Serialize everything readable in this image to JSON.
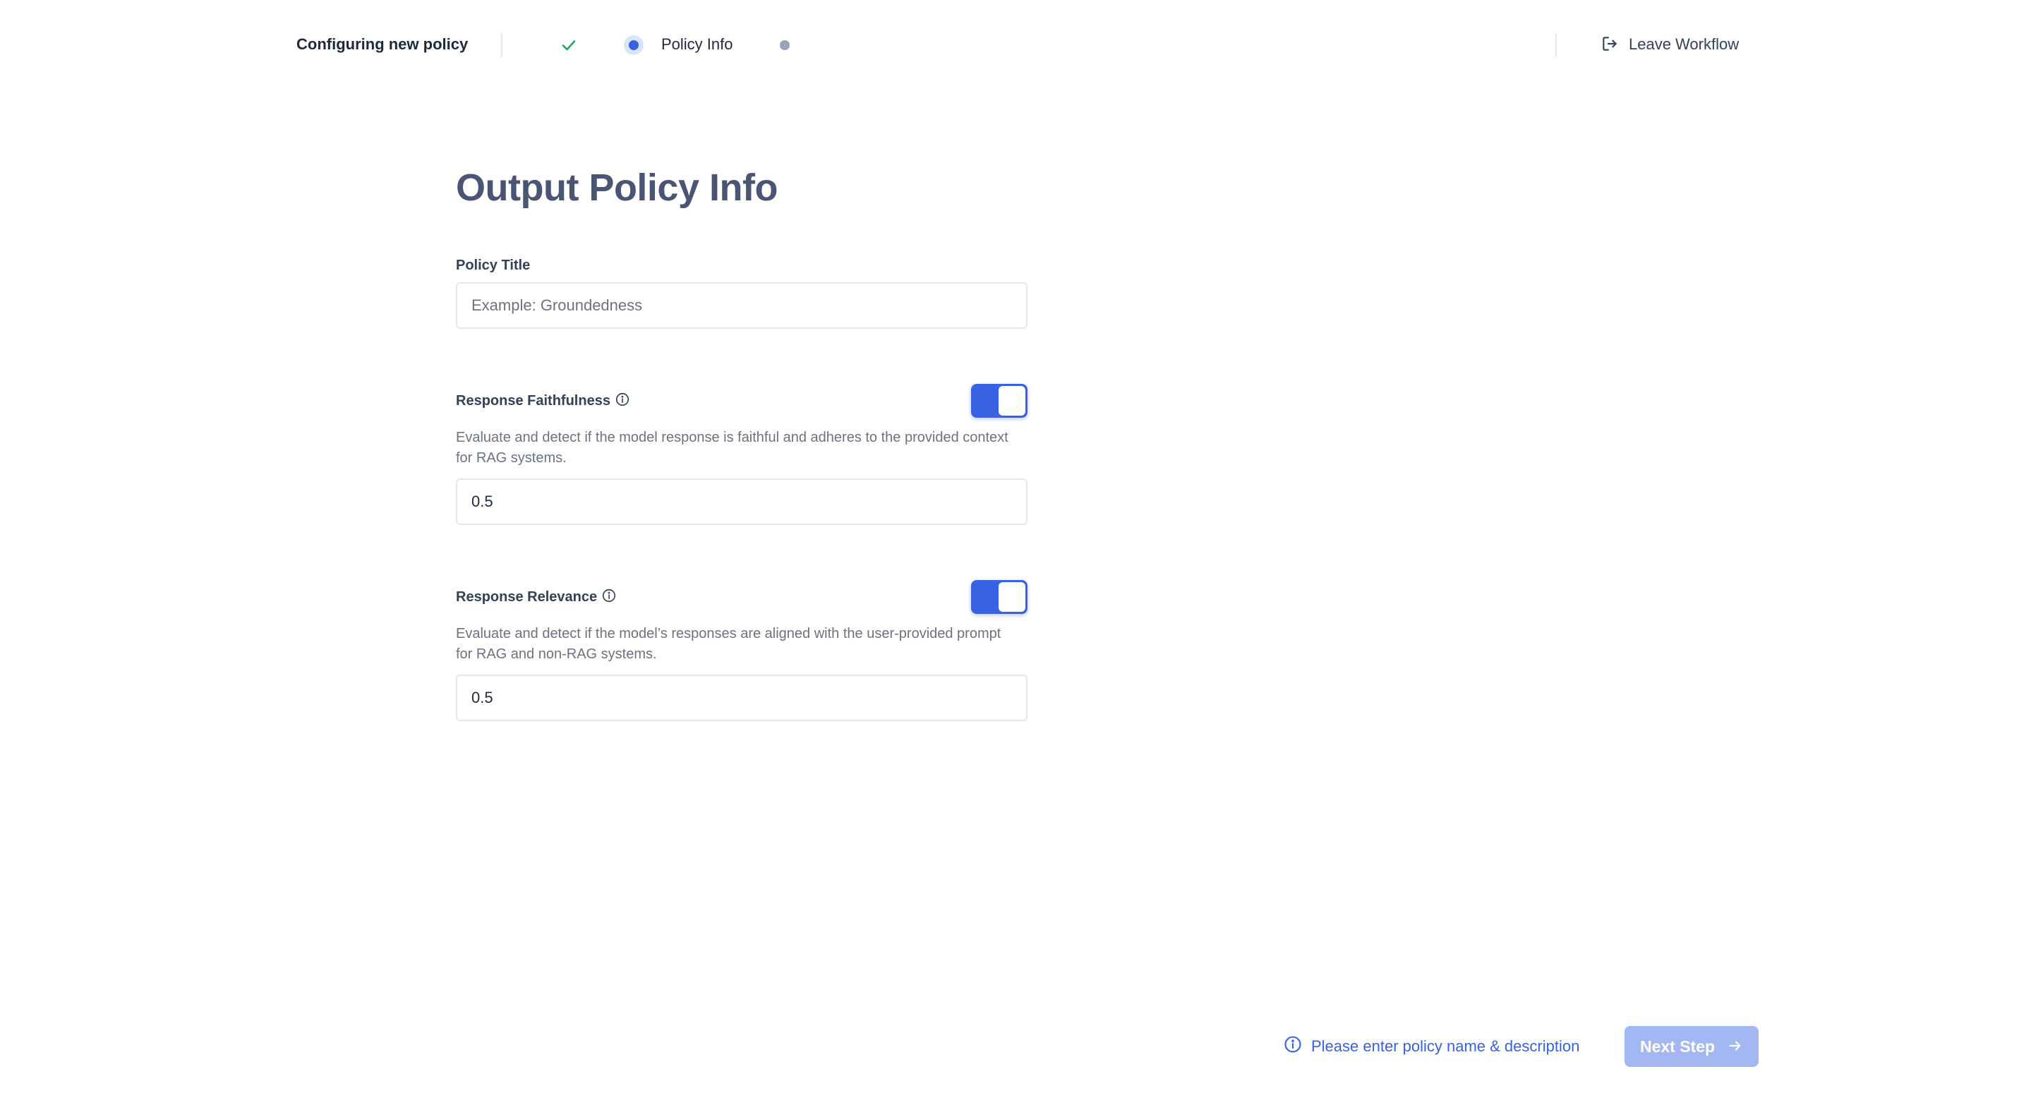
{
  "header": {
    "workflow_title": "Configuring new policy",
    "steps": [
      {
        "state": "completed",
        "icon": "check-icon"
      },
      {
        "state": "current",
        "label": "Policy Info"
      },
      {
        "state": "pending"
      }
    ],
    "leave_label": "Leave Workflow",
    "leave_icon": "exit-icon"
  },
  "form": {
    "title": "Output Policy Info",
    "policy_title": {
      "label": "Policy Title",
      "placeholder": "Example: Groundedness",
      "value": ""
    },
    "policies": [
      {
        "label": "Response Faithfulness",
        "enabled": true,
        "description": "Evaluate and detect if the model response is faithful and adheres to the provided context for RAG systems.",
        "threshold": "0.5"
      },
      {
        "label": "Response Relevance",
        "enabled": true,
        "description": "Evaluate and detect if the model’s responses are aligned with the user-provided prompt for RAG and non-RAG systems.",
        "threshold": "0.5"
      }
    ]
  },
  "footer": {
    "hint": "Please enter policy name & description",
    "next_label": "Next Step",
    "next_enabled": false
  },
  "colors": {
    "accent": "#3662e3",
    "accent_disabled": "#a3b8f2",
    "title": "#4a5573",
    "check": "#22a35a"
  }
}
